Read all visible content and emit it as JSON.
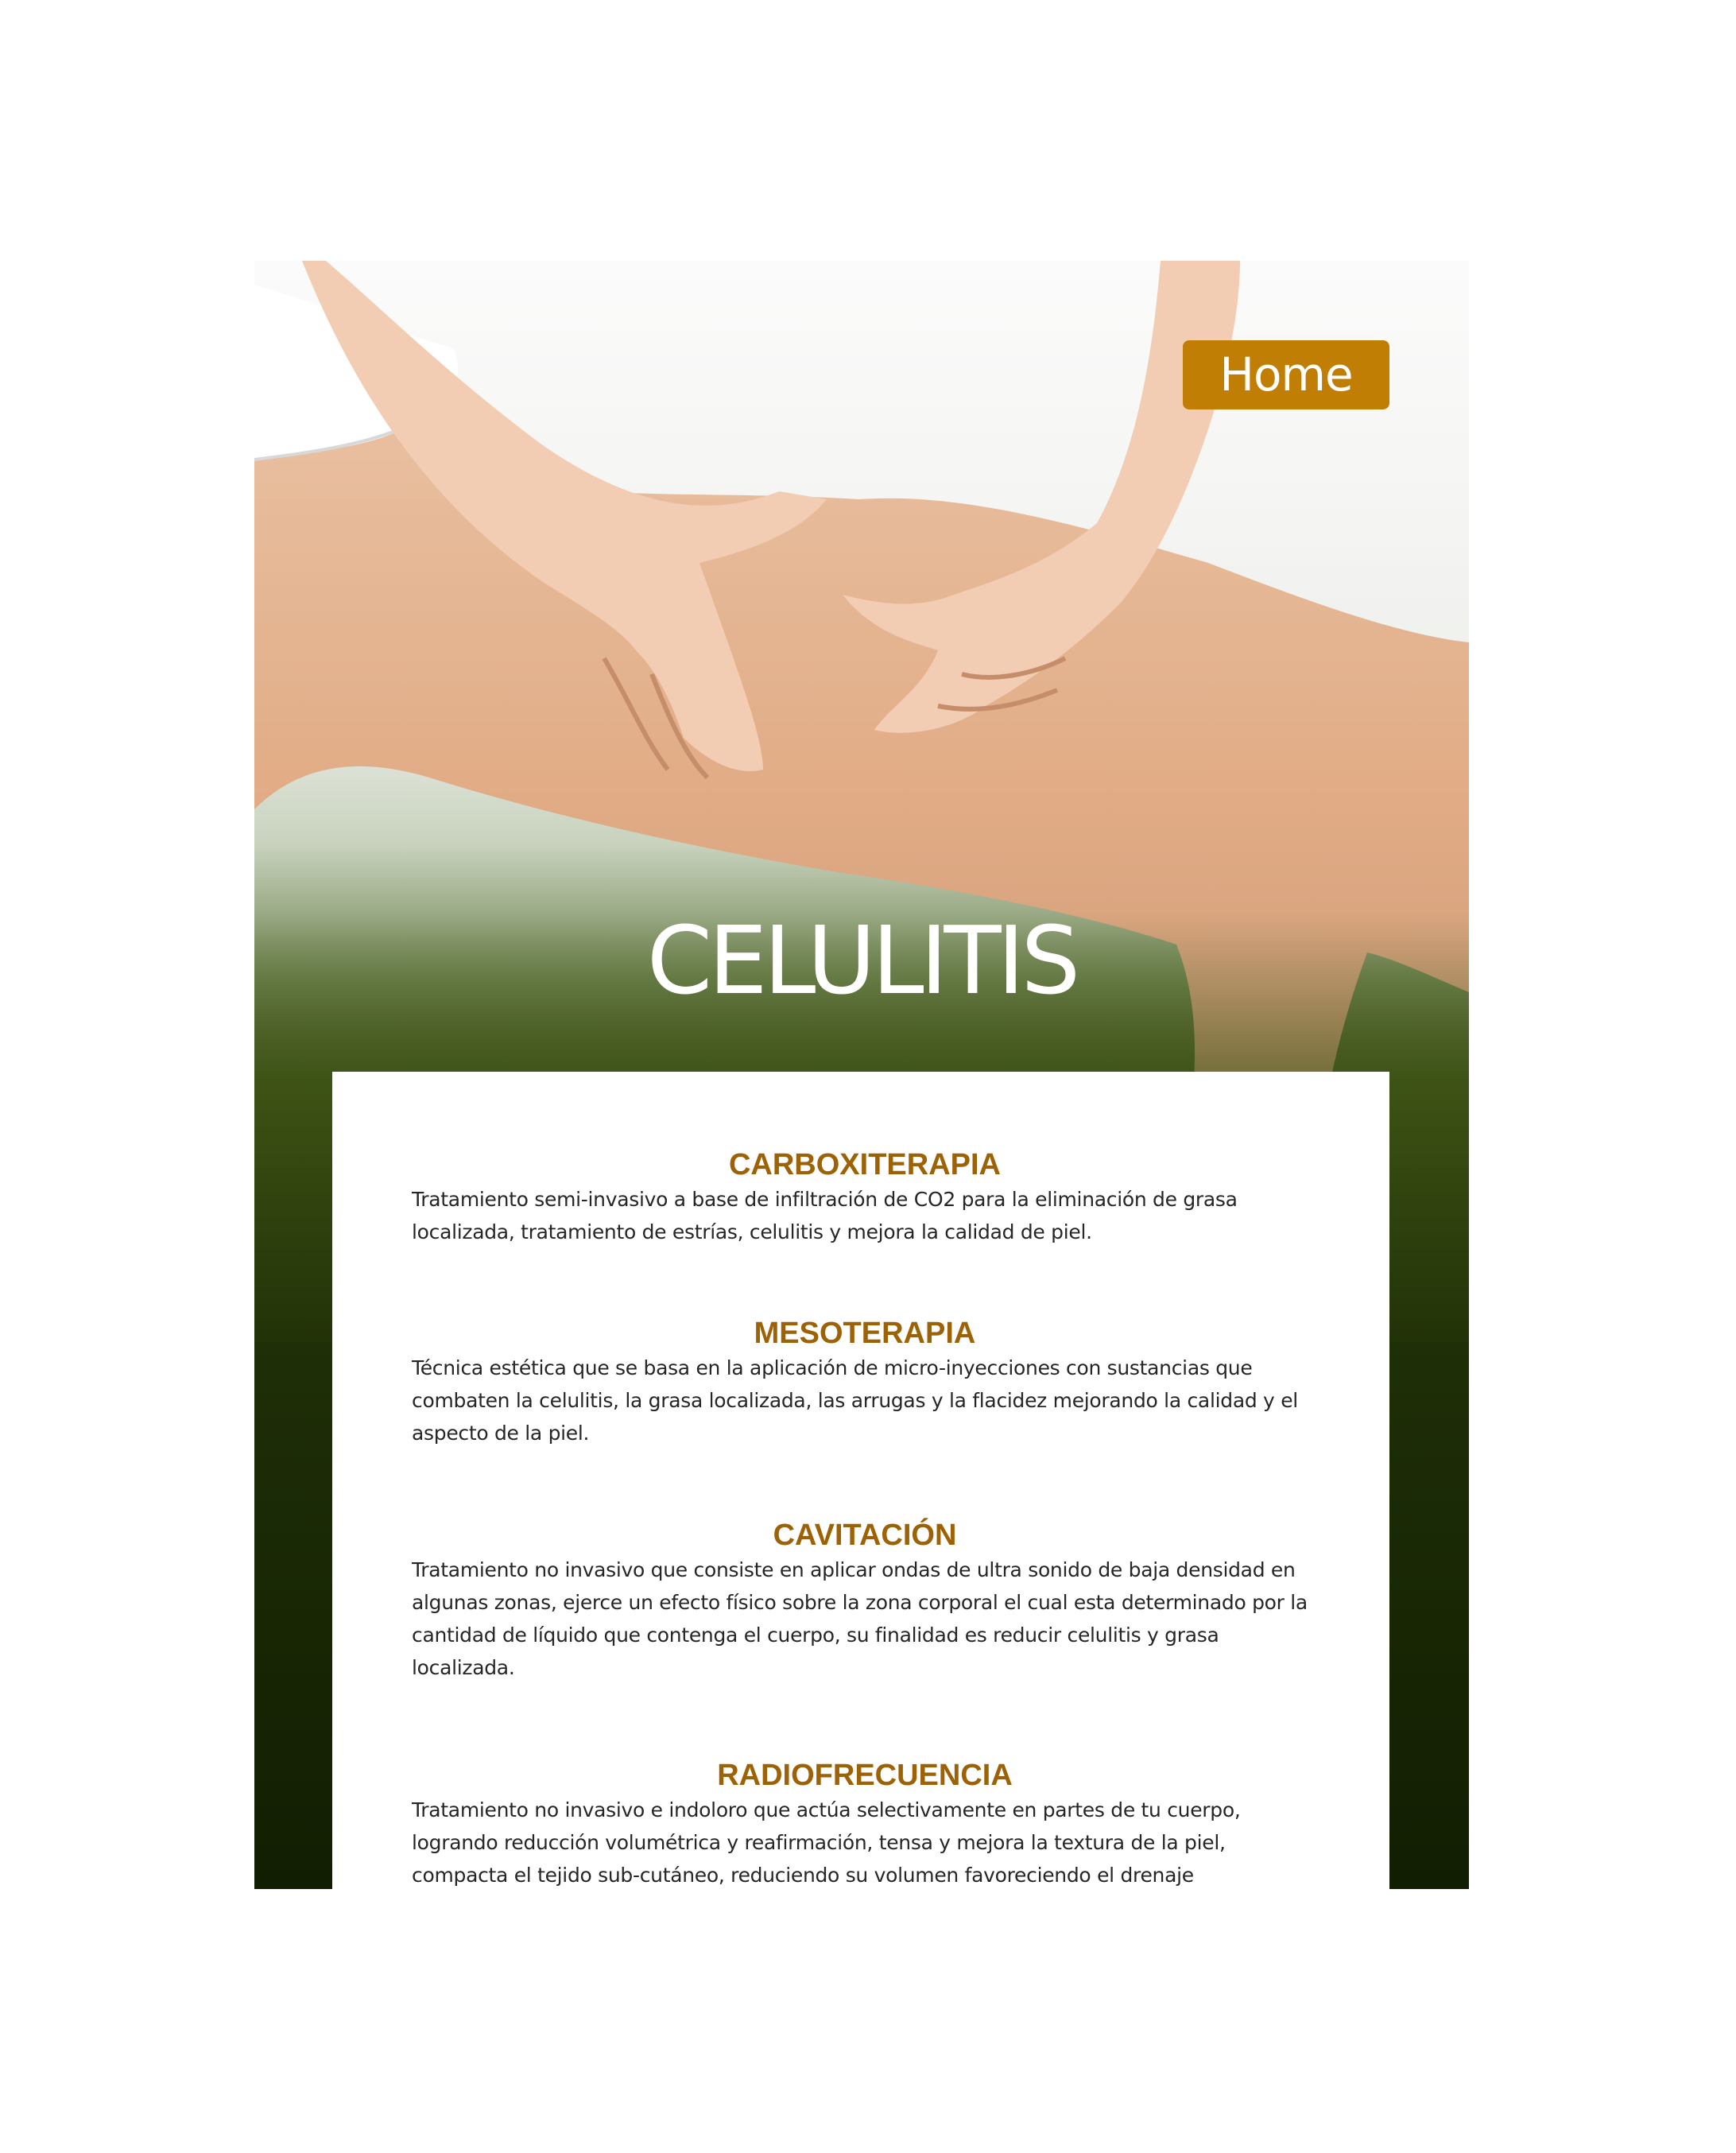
{
  "header": {
    "home_label": "Home",
    "page_title": "CELULITIS"
  },
  "colors": {
    "accent": "#c07f04",
    "heading": "#9d6205",
    "panel_dark": "#132003",
    "panel_mid": "#2b3a0b",
    "skin": "#e3b089",
    "text": "#262626"
  },
  "hero_image": {
    "icon": "legs-hands-photo"
  },
  "treatments": [
    {
      "title": "CARBOXITERAPIA",
      "description": "Tratamiento semi-invasivo a base de infiltración de CO2 para la eliminación de grasa localizada, tratamiento de estrías, celulitis y mejora la calidad de piel."
    },
    {
      "title": "MESOTERAPIA",
      "description": "Técnica estética que se basa en la aplicación de micro-inyecciones con sustancias que combaten la celulitis, la grasa localizada, las arrugas y la flacidez mejorando la calidad y el aspecto de la piel."
    },
    {
      "title": "CAVITACIÓN",
      "description": "Tratamiento no invasivo que consiste en aplicar ondas de ultra sonido de baja densidad en algunas zonas, ejerce un efecto físico sobre la zona corporal el cual esta determinado por la cantidad de líquido que contenga el cuerpo, su finalidad es reducir celulitis y grasa localizada."
    },
    {
      "title": "RADIOFRECUENCIA",
      "description": "Tratamiento no invasivo e indoloro que actúa selectivamente en partes de tu cuerpo, logrando reducción volumétrica y reafirmación, tensa y mejora la textura de la piel, compacta el tejido sub-cutáneo, reduciendo su volumen favoreciendo el drenaje"
    }
  ]
}
